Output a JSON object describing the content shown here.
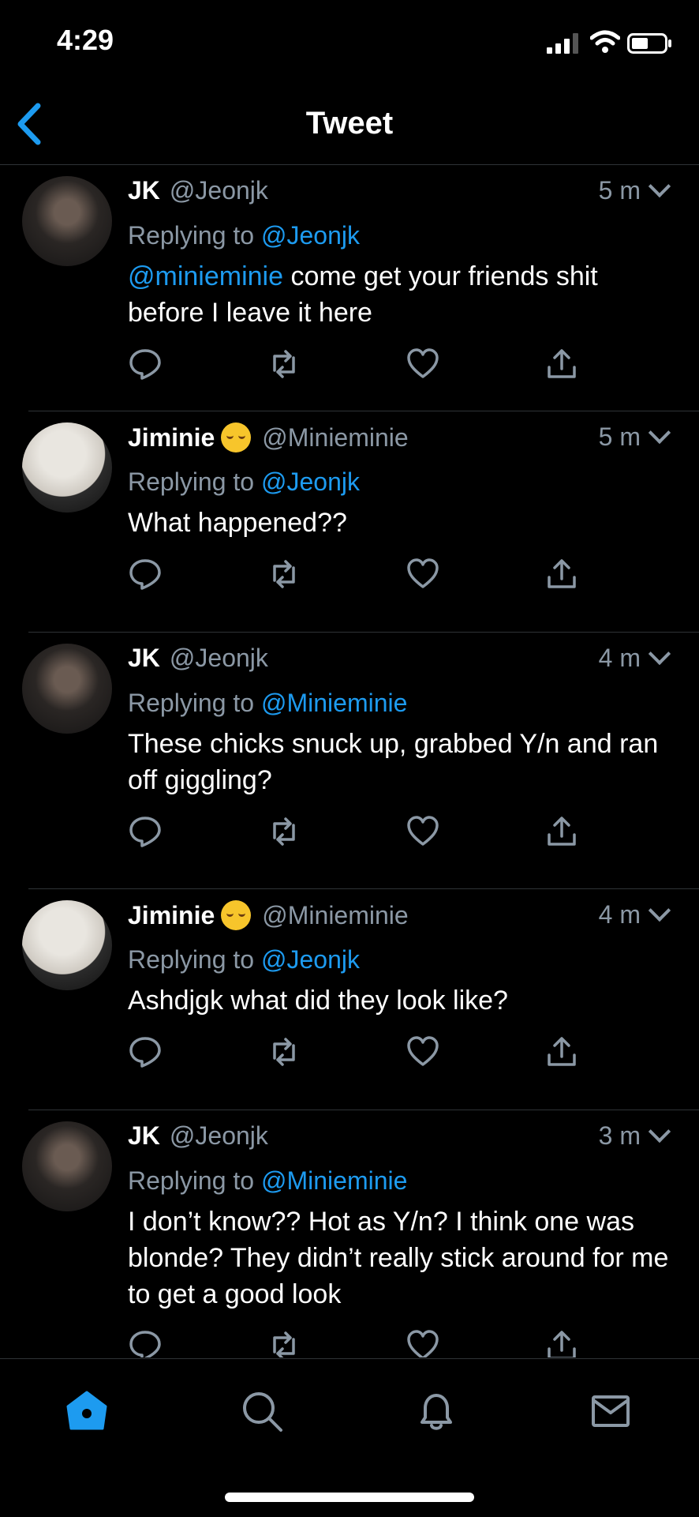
{
  "status": {
    "time": "4:29"
  },
  "header": {
    "title": "Tweet"
  },
  "tweets": [
    {
      "name": "JK",
      "handle": "@Jeonjk",
      "time": "5 m",
      "reply_prefix": "Replying to",
      "reply_to": "@Jeonjk",
      "mention": "@minieminie",
      "text": " come get your friends shit before I leave it here",
      "avatar": "jk"
    },
    {
      "name": "Jiminie",
      "emoji": "relieved-face",
      "handle": "@Minieminie",
      "time": "5 m",
      "reply_prefix": "Replying to",
      "reply_to": "@Jeonjk",
      "mention": "",
      "text": "What happened??",
      "avatar": "jm"
    },
    {
      "name": "JK",
      "handle": "@Jeonjk",
      "time": "4 m",
      "reply_prefix": "Replying to",
      "reply_to": "@Minieminie",
      "mention": "",
      "text": "These chicks snuck up, grabbed Y/n and ran off giggling?",
      "avatar": "jk"
    },
    {
      "name": "Jiminie",
      "emoji": "relieved-face",
      "handle": "@Minieminie",
      "time": "4 m",
      "reply_prefix": "Replying to",
      "reply_to": "@Jeonjk",
      "mention": "",
      "text": "Ashdjgk what did they look like?",
      "avatar": "jm"
    },
    {
      "name": "JK",
      "handle": "@Jeonjk",
      "time": "3 m",
      "reply_prefix": "Replying to",
      "reply_to": "@Minieminie",
      "mention": "",
      "text": "I don’t know?? Hot as Y/n? I think one was blonde? They didn’t really stick around for me to get a good look",
      "avatar": "jk"
    }
  ],
  "tabbar": {
    "items": [
      "home-icon",
      "search-icon",
      "notifications-icon",
      "messages-icon"
    ],
    "active": "home-icon"
  },
  "colors": {
    "accent": "#1d9bf0",
    "muted": "#8b98a5",
    "divider": "#2f3336"
  }
}
